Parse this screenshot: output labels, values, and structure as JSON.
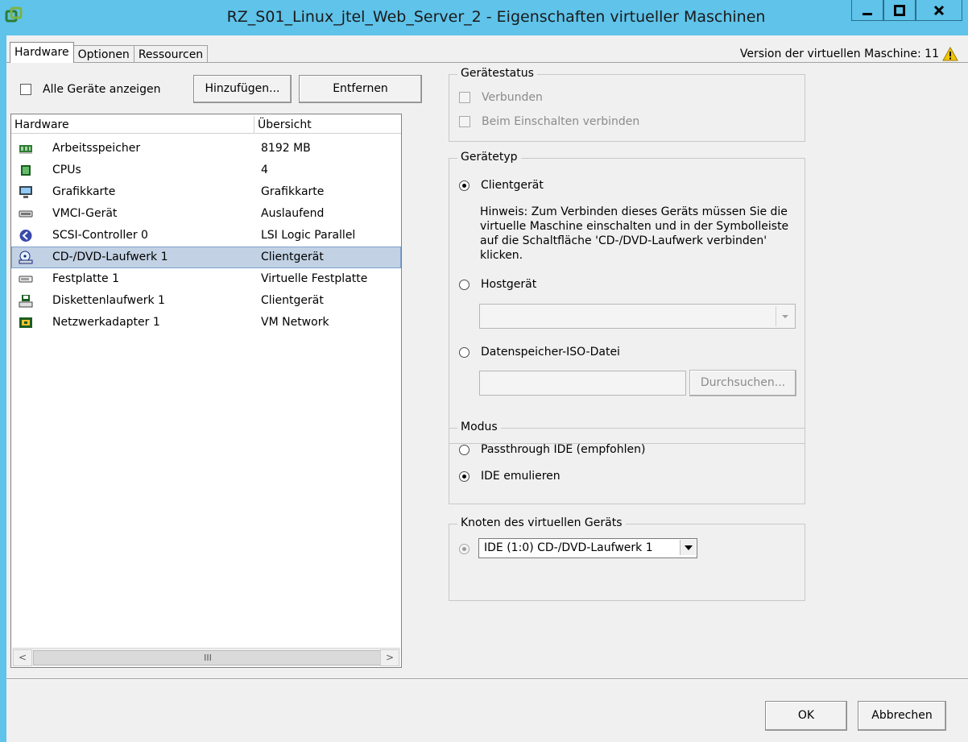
{
  "window": {
    "title": "RZ_S01_Linux_jtel_Web_Server_2 - Eigenschaften virtueller Maschinen"
  },
  "tabs": [
    {
      "label": "Hardware",
      "active": true
    },
    {
      "label": "Optionen",
      "active": false
    },
    {
      "label": "Ressourcen",
      "active": false
    }
  ],
  "version": {
    "label": "Version der virtuellen Maschine: 11"
  },
  "toolbar": {
    "show_all_label": "Alle Geräte anzeigen",
    "add_label": "Hinzufügen...",
    "remove_label": "Entfernen"
  },
  "hardware": {
    "columns": [
      "Hardware",
      "Übersicht"
    ],
    "rows": [
      {
        "name": "Arbeitsspeicher",
        "summary": "8192 MB",
        "icon": "memory-icon"
      },
      {
        "name": "CPUs",
        "summary": "4",
        "icon": "cpu-icon"
      },
      {
        "name": "Grafikkarte",
        "summary": "Grafikkarte",
        "icon": "monitor-icon"
      },
      {
        "name": "VMCI-Gerät",
        "summary": "Auslaufend",
        "icon": "vmci-device-icon"
      },
      {
        "name": "SCSI-Controller 0",
        "summary": "LSI Logic Parallel",
        "icon": "scsi-controller-icon"
      },
      {
        "name": "CD-/DVD-Laufwerk 1",
        "summary": "Clientgerät",
        "icon": "cd-dvd-drive-icon",
        "selected": true
      },
      {
        "name": "Festplatte 1",
        "summary": "Virtuelle Festplatte",
        "icon": "hard-disk-icon"
      },
      {
        "name": "Diskettenlaufwerk 1",
        "summary": "Clientgerät",
        "icon": "floppy-drive-icon"
      },
      {
        "name": "Netzwerkadapter 1",
        "summary": "VM Network",
        "icon": "network-adapter-icon"
      }
    ],
    "scrollbar": {
      "left": "<",
      "right": ">",
      "thumb": "III"
    }
  },
  "device_status": {
    "legend": "Gerätestatus",
    "connected_label": "Verbunden",
    "connect_on_power_label": "Beim Einschalten verbinden"
  },
  "device_type": {
    "legend": "Gerätetyp",
    "client_label": "Clientgerät",
    "hint": "Hinweis: Zum Verbinden dieses Geräts müssen Sie die virtuelle Maschine einschalten und in der Symbolleiste auf die Schaltfläche 'CD-/DVD-Laufwerk verbinden' klicken.",
    "host_label": "Hostgerät",
    "iso_label": "Datenspeicher-ISO-Datei",
    "browse_label": "Durchsuchen..."
  },
  "mode": {
    "legend": "Modus",
    "passthrough_label": "Passthrough IDE (empfohlen)",
    "emulate_label": "IDE emulieren"
  },
  "node": {
    "legend": "Knoten des virtuellen Geräts",
    "selected": "IDE (1:0) CD-/DVD-Laufwerk 1"
  },
  "footer": {
    "ok_label": "OK",
    "cancel_label": "Abbrechen"
  },
  "colors": {
    "titlebar": "#5fc3ea",
    "selection": "#c2d2e4",
    "warning": "#f2c500"
  }
}
